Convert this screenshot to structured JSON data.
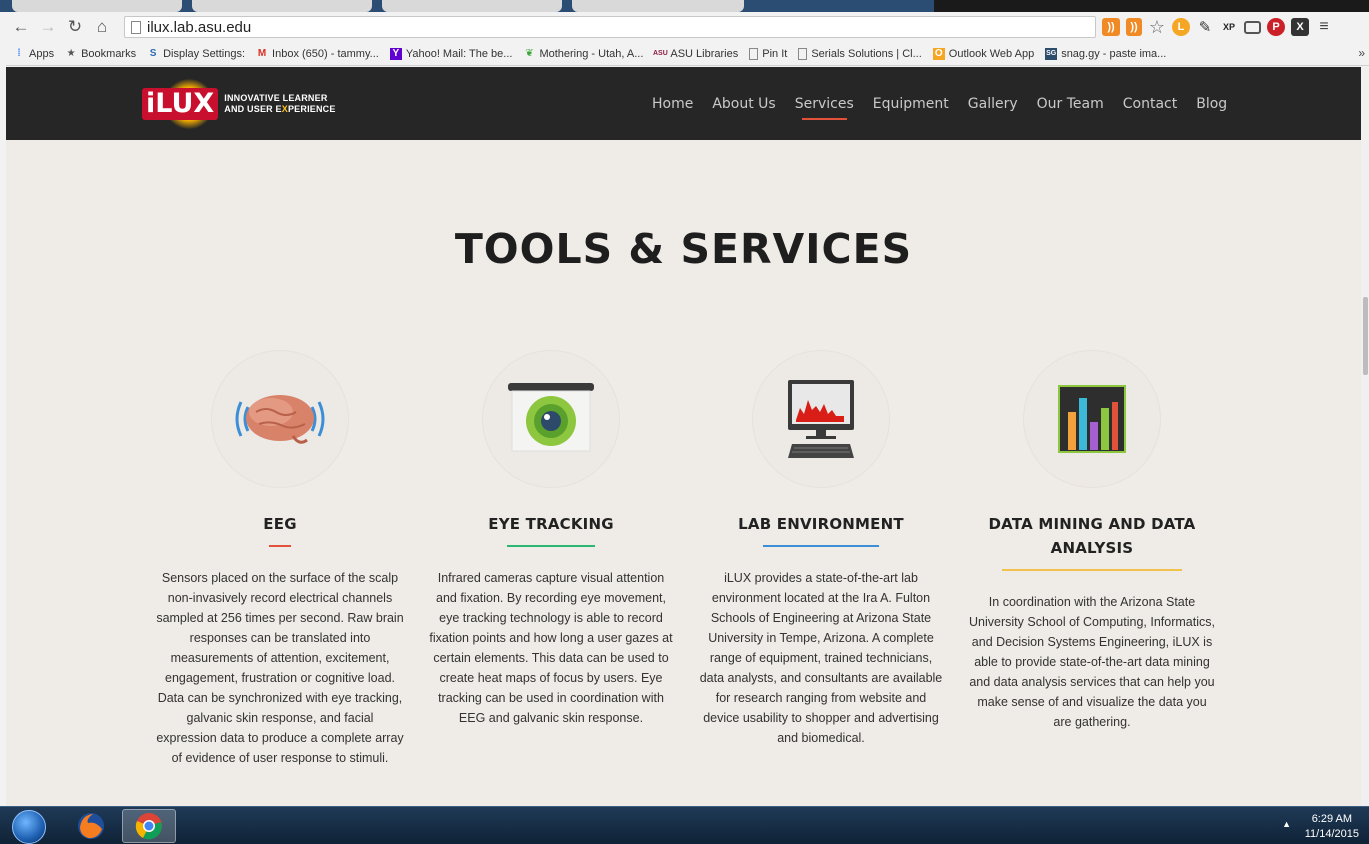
{
  "browser": {
    "url": "ilux.lab.asu.edu",
    "bookmarks": [
      {
        "label": "Apps",
        "icon": "apps-grid-icon"
      },
      {
        "label": "Bookmarks",
        "icon": "star-icon"
      },
      {
        "label": "Display Settings:",
        "icon": "display-settings-icon"
      },
      {
        "label": "Inbox (650) - tammy...",
        "icon": "gmail-icon"
      },
      {
        "label": "Yahoo! Mail: The be...",
        "icon": "yahoo-icon"
      },
      {
        "label": "Mothering - Utah, A...",
        "icon": "leaf-icon"
      },
      {
        "label": "ASU Libraries",
        "icon": "asu-icon"
      },
      {
        "label": "Pin It",
        "icon": "page-icon"
      },
      {
        "label": "Serials Solutions | Cl...",
        "icon": "page-icon"
      },
      {
        "label": "Outlook Web App",
        "icon": "outlook-icon"
      },
      {
        "label": "snag.gy - paste ima...",
        "icon": "snaggy-icon"
      }
    ],
    "bookmarks_more": "»"
  },
  "site": {
    "logo_word": "iLUX",
    "logo_tag_line1": "INNOVATIVE LEARNER",
    "logo_tag_line2_a": "AND USER E",
    "logo_tag_line2_b": "X",
    "logo_tag_line2_c": "PERIENCE",
    "nav": [
      {
        "label": "Home"
      },
      {
        "label": "About Us"
      },
      {
        "label": "Services",
        "active": true
      },
      {
        "label": "Equipment"
      },
      {
        "label": "Gallery"
      },
      {
        "label": "Our Team"
      },
      {
        "label": "Contact"
      },
      {
        "label": "Blog"
      }
    ],
    "accent": "#e2523a"
  },
  "main": {
    "title": "TOOLS & SERVICES",
    "services": [
      {
        "title": "EEG",
        "underline_color": "#e2523a",
        "icon": "brain-icon",
        "description": "Sensors placed on the surface of the scalp non-invasively record electrical channels sampled at 256 times per second. Raw brain responses can be translated into measurements of attention, excitement, engagement, frustration or cognitive load. Data can be synchronized with eye tracking, galvanic skin response, and facial expression data to produce a complete array of evidence of user response to stimuli."
      },
      {
        "title": "EYE TRACKING",
        "underline_color": "#2bb673",
        "icon": "eye-tracker-icon",
        "description": "Infrared cameras capture visual attention and fixation. By recording eye movement, eye tracking technology is able to record fixation points and how long a user gazes at certain elements. This data can be used to create heat maps of focus by users. Eye tracking can be used in coordination with EEG and galvanic skin response."
      },
      {
        "title": "LAB ENVIRONMENT",
        "underline_color": "#3c8fd6",
        "icon": "computer-icon",
        "description": "iLUX provides a state-of-the-art lab environment located at the Ira A. Fulton Schools of Engineering at Arizona State University in Tempe, Arizona. A complete range of equipment, trained technicians, data analysts, and consultants are available for research ranging from website and device usability to shopper and advertising and biomedical."
      },
      {
        "title": "DATA MINING AND DATA ANALYSIS",
        "underline_color": "#f2c14e",
        "icon": "bar-chart-icon",
        "description": "In coordination with the Arizona State University School of Computing, Informatics, and Decision Systems Engineering, iLUX is able to provide state-of-the-art data mining and data analysis services that can help you make sense of and visualize the data you are gathering."
      }
    ]
  },
  "taskbar": {
    "time": "6:29 AM",
    "date": "11/14/2015"
  }
}
